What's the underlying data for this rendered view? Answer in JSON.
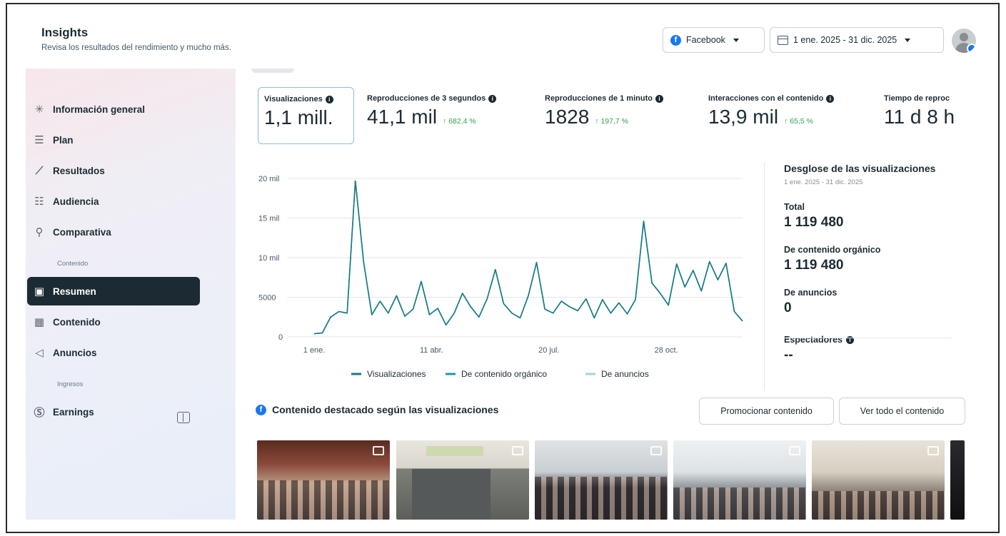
{
  "header": {
    "title": "Insights",
    "subtitle": "Revisa los resultados del rendimiento y mucho más.",
    "platform_label": "Facebook",
    "date_range": "1 ene. 2025 - 31 dic. 2025"
  },
  "sidebar": {
    "items": [
      {
        "label": "Información general",
        "icon": "overview-icon"
      },
      {
        "label": "Plan",
        "icon": "list-icon"
      },
      {
        "label": "Resultados",
        "icon": "trend-icon"
      },
      {
        "label": "Audiencia",
        "icon": "audience-icon"
      },
      {
        "label": "Comparativa",
        "icon": "compare-icon"
      },
      {
        "label": "Resumen",
        "icon": "summary-icon",
        "active": true
      },
      {
        "label": "Contenido",
        "icon": "table-icon"
      },
      {
        "label": "Anuncios",
        "icon": "megaphone-icon"
      },
      {
        "label": "Earnings",
        "icon": "dollar-icon"
      }
    ],
    "section_contenido": "Contenido",
    "section_ingresos": "Ingresos"
  },
  "metrics": [
    {
      "label": "Visualizaciones",
      "value": "1,1 mill.",
      "delta": ""
    },
    {
      "label": "Reproducciones de 3 segundos",
      "value": "41,1 mil",
      "delta": "↑ 682,4 %"
    },
    {
      "label": "Reproducciones de 1 minuto",
      "value": "1828",
      "delta": "↑ 197,7 %"
    },
    {
      "label": "Interacciones con el contenido",
      "value": "13,9 mil",
      "delta": "↑ 65,5 %"
    },
    {
      "label": "Tiempo de reproc",
      "value": "11 d 8 h",
      "delta": ""
    }
  ],
  "chart_data": {
    "type": "line",
    "title": "",
    "xlabel": "",
    "ylabel": "",
    "ylim": [
      0,
      20000
    ],
    "y_ticks": [
      "0",
      "5000",
      "10 mil",
      "15 mil",
      "20 mil"
    ],
    "x_ticks": [
      "1 ene.",
      "11 abr.",
      "20 jul.",
      "28 oct."
    ],
    "grid": true,
    "legend_position": "bottom",
    "x": [
      "1 ene.",
      "8 ene.",
      "15 ene.",
      "22 ene.",
      "29 ene.",
      "5 feb.",
      "12 feb.",
      "19 feb.",
      "26 feb.",
      "5 mar.",
      "12 mar.",
      "19 mar.",
      "26 mar.",
      "2 abr.",
      "9 abr.",
      "16 abr.",
      "23 abr.",
      "30 abr.",
      "7 may.",
      "14 may.",
      "21 may.",
      "28 may.",
      "4 jun.",
      "11 jun.",
      "18 jun.",
      "25 jun.",
      "2 jul.",
      "9 jul.",
      "16 jul.",
      "23 jul.",
      "30 jul.",
      "6 ago.",
      "13 ago.",
      "20 ago.",
      "27 ago.",
      "3 sep.",
      "10 sep.",
      "17 sep.",
      "24 sep.",
      "1 oct.",
      "8 oct.",
      "15 oct.",
      "22 oct.",
      "29 oct.",
      "5 nov.",
      "12 nov.",
      "19 nov.",
      "26 nov.",
      "3 dic.",
      "10 dic.",
      "17 dic.",
      "24 dic.",
      "31 dic."
    ],
    "series": [
      {
        "name": "Visualizaciones",
        "color": "#1b7a83",
        "values": [
          400,
          500,
          2500,
          3200,
          3000,
          19700,
          9500,
          2800,
          4500,
          3000,
          5200,
          2600,
          3500,
          7000,
          2800,
          3600,
          1500,
          3000,
          5500,
          3800,
          2500,
          4800,
          8500,
          4200,
          3000,
          2400,
          5200,
          9400,
          3500,
          3000,
          4500,
          3800,
          3300,
          4800,
          2400,
          4700,
          3000,
          4300,
          2900,
          4700,
          14600,
          6800,
          5500,
          4000,
          9200,
          6300,
          8400,
          5800,
          9500,
          7200,
          9300,
          3200,
          2000
        ]
      },
      {
        "name": "De contenido orgánico",
        "color": "#1b9aab",
        "values": [
          400,
          500,
          2500,
          3200,
          3000,
          19700,
          9500,
          2800,
          4500,
          3000,
          5200,
          2600,
          3500,
          7000,
          2800,
          3600,
          1500,
          3000,
          5500,
          3800,
          2500,
          4800,
          8500,
          4200,
          3000,
          2400,
          5200,
          9400,
          3500,
          3000,
          4500,
          3800,
          3300,
          4800,
          2400,
          4700,
          3000,
          4300,
          2900,
          4700,
          14600,
          6800,
          5500,
          4000,
          9200,
          6300,
          8400,
          5800,
          9500,
          7200,
          9300,
          3200,
          2000
        ]
      },
      {
        "name": "De anuncios",
        "color": "#9fd3e6",
        "values": [
          0,
          0,
          0,
          0,
          0,
          0,
          0,
          0,
          0,
          0,
          0,
          0,
          0,
          0,
          0,
          0,
          0,
          0,
          0,
          0,
          0,
          0,
          0,
          0,
          0,
          0,
          0,
          0,
          0,
          0,
          0,
          0,
          0,
          0,
          0,
          0,
          0,
          0,
          0,
          0,
          0,
          0,
          0,
          0,
          0,
          0,
          0,
          0,
          0,
          0,
          0,
          0,
          0
        ]
      }
    ]
  },
  "breakdown": {
    "title": "Desglose de las visualizaciones",
    "range": "1 ene. 2025 - 31 dic. 2025",
    "total_label": "Total",
    "total_value": "1 119 480",
    "organic_label": "De contenido orgánico",
    "organic_value": "1 119 480",
    "ads_label": "De anuncios",
    "ads_value": "0",
    "viewers_label": "Espectadores",
    "viewers_value": "--"
  },
  "featured": {
    "title": "Contenido destacado según las visualizaciones",
    "promote_button": "Promocionar contenido",
    "view_all_button": "Ver todo el contenido"
  }
}
